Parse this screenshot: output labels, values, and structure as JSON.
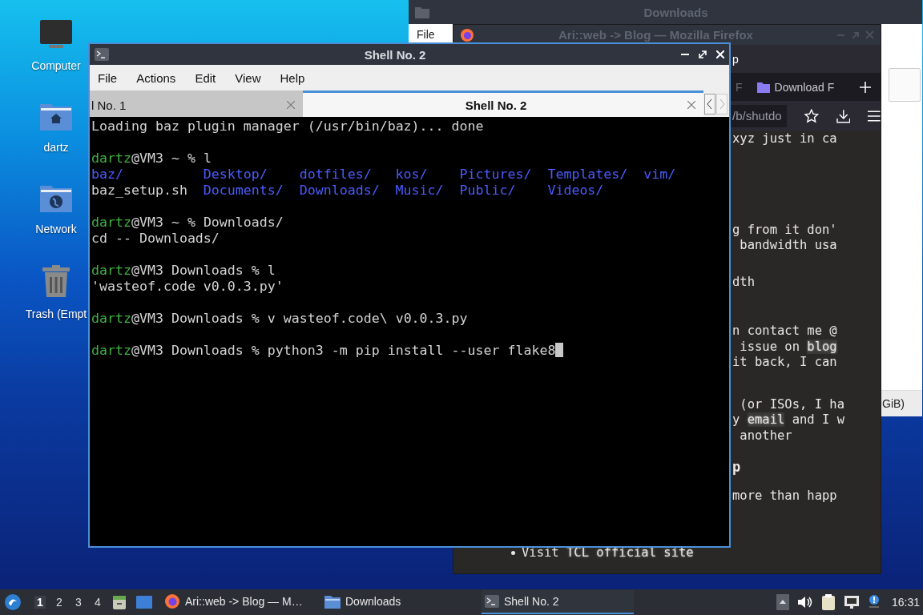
{
  "desktop_icons": [
    {
      "label": "Computer",
      "kind": "computer"
    },
    {
      "label": "dartz",
      "kind": "home"
    },
    {
      "label": "Network",
      "kind": "network"
    },
    {
      "label": "Trash (Empt",
      "kind": "trash"
    }
  ],
  "file_manager": {
    "title": "Downloads",
    "menu": [
      "File"
    ],
    "status_text": "GiB)"
  },
  "firefox": {
    "title": "Ari::web -> Blog — Mozilla Firefox",
    "toolbar_text": "p",
    "tabs": [
      {
        "label": "F",
        "kind": "plain"
      },
      {
        "label": "Download F",
        "kind": "download"
      }
    ],
    "url": "/b/shutdo",
    "content": [
      {
        "kind": "text",
        "lines": [
          [
            {
              "t": "xyz just in ca",
              "kind": "text"
            }
          ]
        ]
      },
      {
        "kind": "text",
        "lines": [
          [
            {
              "t": "g from it don'",
              "kind": "text"
            }
          ],
          [
            {
              "t": " bandwidth usa",
              "kind": "text"
            }
          ]
        ]
      },
      {
        "kind": "text",
        "lines": [
          [
            {
              "t": "dth",
              "kind": "text"
            }
          ]
        ]
      },
      {
        "kind": "text",
        "lines": [
          [
            {
              "t": "n contact me @",
              "kind": "text"
            }
          ],
          [
            {
              "t": " issue on ",
              "kind": "text"
            },
            {
              "t": "blog",
              "kind": "code"
            }
          ],
          [
            {
              "t": "it back, I can",
              "kind": "text"
            }
          ]
        ]
      },
      {
        "kind": "text",
        "lines": [
          [
            {
              "t": " (or ISOs, I ha",
              "kind": "text"
            }
          ],
          [
            {
              "t": "y ",
              "kind": "text"
            },
            {
              "t": "email",
              "kind": "code"
            },
            {
              "t": " and I w",
              "kind": "text"
            }
          ],
          [
            {
              "t": " another",
              "kind": "text"
            }
          ]
        ]
      },
      {
        "kind": "heading",
        "lines": [
          [
            {
              "t": "p",
              "kind": "text"
            }
          ]
        ]
      },
      {
        "kind": "text",
        "lines": [
          [
            {
              "t": "more than happ",
              "kind": "text"
            }
          ]
        ]
      },
      {
        "kind": "bullet",
        "lines": [
          [
            {
              "t": "Visit ",
              "kind": "text"
            },
            {
              "t": "TCL official site",
              "kind": "link"
            }
          ]
        ]
      }
    ]
  },
  "terminal": {
    "title": "Shell No. 2",
    "menu": [
      "File",
      "Actions",
      "Edit",
      "View",
      "Help"
    ],
    "tabs": [
      {
        "label": "l No. 1",
        "selected": false
      },
      {
        "label": "Shell No. 2",
        "selected": true
      }
    ],
    "lines": [
      {
        "kind": "output",
        "text": "Loading baz plugin manager (/usr/bin/baz)... done"
      },
      {
        "kind": "blank"
      },
      {
        "kind": "prompt",
        "user": "dartz",
        "prompt": "@VM3 ~ % ",
        "command": "l"
      },
      {
        "kind": "ls",
        "entries": [
          {
            "name": "baz/",
            "kind": "dir"
          },
          {
            "name": "Desktop/",
            "kind": "dir"
          },
          {
            "name": "dotfiles/",
            "kind": "dir"
          },
          {
            "name": "kos/",
            "kind": "dir"
          },
          {
            "name": "Pictures/",
            "kind": "dir"
          },
          {
            "name": "Templates/",
            "kind": "dir"
          },
          {
            "name": "vim/",
            "kind": "dir"
          },
          {
            "name": "baz_setup.sh",
            "kind": "file"
          },
          {
            "name": "Documents/",
            "kind": "dir"
          },
          {
            "name": "Downloads/",
            "kind": "dir"
          },
          {
            "name": "Music/",
            "kind": "dir"
          },
          {
            "name": "Public/",
            "kind": "dir"
          },
          {
            "name": "Videos/",
            "kind": "dir"
          }
        ]
      },
      {
        "kind": "blank"
      },
      {
        "kind": "prompt",
        "user": "dartz",
        "prompt": "@VM3 ~ % ",
        "command": "Downloads/"
      },
      {
        "kind": "output",
        "text": "cd -- Downloads/"
      },
      {
        "kind": "blank"
      },
      {
        "kind": "prompt",
        "user": "dartz",
        "prompt": "@VM3 Downloads % ",
        "command": "l"
      },
      {
        "kind": "output",
        "text": "'wasteof.code v0.0.3.py'"
      },
      {
        "kind": "blank"
      },
      {
        "kind": "prompt",
        "user": "dartz",
        "prompt": "@VM3 Downloads % ",
        "command": "v wasteof.code\\ v0.0.3.py"
      },
      {
        "kind": "blank"
      },
      {
        "kind": "prompt",
        "user": "dartz",
        "prompt": "@VM3 Downloads % ",
        "command": "python3 -m pip install --user flake8",
        "cursor": true
      }
    ]
  },
  "taskbar": {
    "workspaces": [
      {
        "label": "1",
        "selected": true
      },
      {
        "label": "2",
        "selected": false
      },
      {
        "label": "3",
        "selected": false
      },
      {
        "label": "4",
        "selected": false
      }
    ],
    "tasks": [
      {
        "label": "Ari::web -> Blog — M…",
        "kind": "firefox",
        "selected": false
      },
      {
        "label": "Downloads",
        "kind": "folder",
        "selected": false
      },
      {
        "label": "Shell No. 2",
        "kind": "terminal",
        "selected": true
      }
    ],
    "clock": "16:31"
  }
}
